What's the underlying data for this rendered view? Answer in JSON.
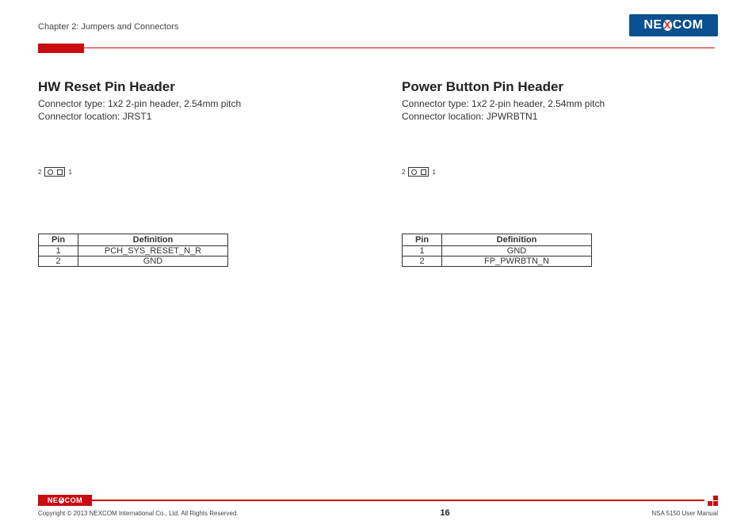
{
  "header": {
    "chapter": "Chapter 2: Jumpers and Connectors",
    "logo_text_pre": "NE",
    "logo_text_x": "X",
    "logo_text_post": "COM"
  },
  "sections": [
    {
      "title": "HW Reset Pin Header",
      "connector_type": "Connector type: 1x2 2-pin header, 2.54mm pitch",
      "connector_location": "Connector location: JRST1",
      "pin_left_label": "2",
      "pin_right_label": "1",
      "table_header_pin": "Pin",
      "table_header_def": "Definition",
      "rows": [
        {
          "pin": "1",
          "def": "PCH_SYS_RESET_N_R"
        },
        {
          "pin": "2",
          "def": "GND"
        }
      ]
    },
    {
      "title": "Power Button Pin Header",
      "connector_type": "Connector type: 1x2 2-pin header, 2.54mm pitch",
      "connector_location": "Connector location: JPWRBTN1",
      "pin_left_label": "2",
      "pin_right_label": "1",
      "table_header_pin": "Pin",
      "table_header_def": "Definition",
      "rows": [
        {
          "pin": "1",
          "def": "GND"
        },
        {
          "pin": "2",
          "def": "FP_PWRBTN_N"
        }
      ]
    }
  ],
  "footer": {
    "copyright": "Copyright © 2013 NEXCOM International Co., Ltd. All Rights Reserved.",
    "page": "16",
    "manual": "NSA 5150 User Manual",
    "logo_text_pre": "NE",
    "logo_text_x": "X",
    "logo_text_post": "COM"
  }
}
